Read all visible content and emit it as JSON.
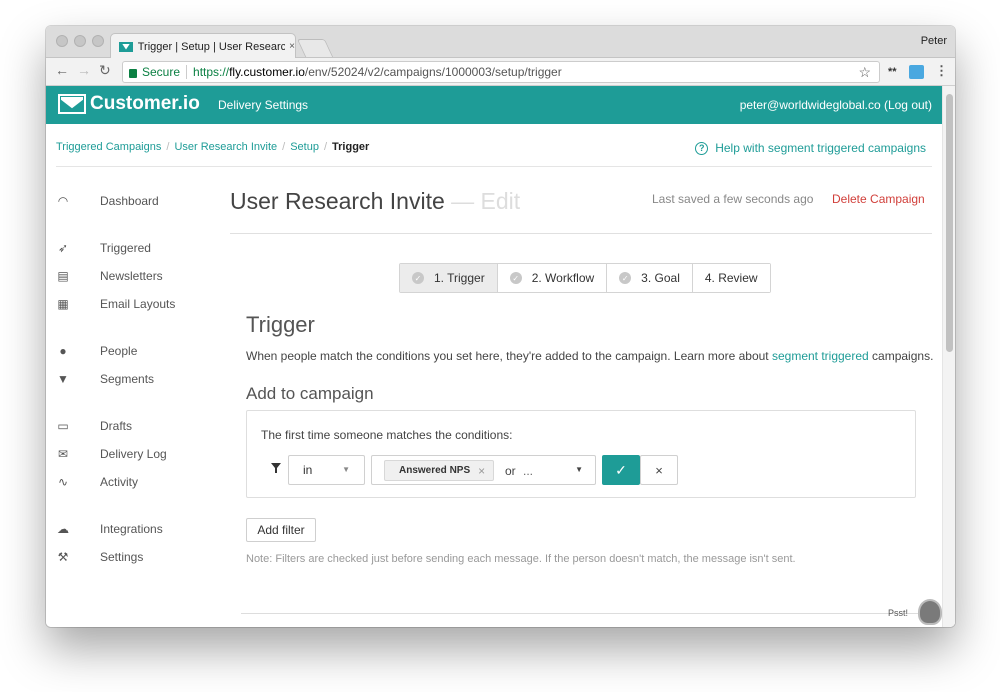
{
  "browser": {
    "tab_title": "Trigger | Setup | User Researc",
    "tab_close": "×",
    "profile_name": "Peter",
    "secure_label": "Secure",
    "url_scheme": "https://",
    "url_host": "fly.customer.io",
    "url_path": "/env/52024/v2/campaigns/1000003/setup/trigger",
    "ext_label": "**"
  },
  "header": {
    "logo_text": "Customer.io",
    "delivery_settings": "Delivery Settings",
    "user_email": "peter@worldwideglobal.co (Log out)"
  },
  "breadcrumb": {
    "items": [
      "Triggered Campaigns",
      "User Research Invite",
      "Setup"
    ],
    "current": "Trigger",
    "divider": "/"
  },
  "help_link": "Help with segment triggered campaigns",
  "sidebar": {
    "items": [
      {
        "label": "Dashboard",
        "icon": "gauge-icon"
      },
      {
        "label": "Triggered",
        "icon": "paper-plane-icon"
      },
      {
        "label": "Newsletters",
        "icon": "newspaper-icon"
      },
      {
        "label": "Email Layouts",
        "icon": "layout-icon"
      },
      {
        "label": "People",
        "icon": "person-icon"
      },
      {
        "label": "Segments",
        "icon": "funnel-icon"
      },
      {
        "label": "Drafts",
        "icon": "draft-icon"
      },
      {
        "label": "Delivery Log",
        "icon": "envelope-icon"
      },
      {
        "label": "Activity",
        "icon": "activity-icon"
      },
      {
        "label": "Integrations",
        "icon": "cloud-icon"
      },
      {
        "label": "Settings",
        "icon": "wrench-icon"
      }
    ]
  },
  "main": {
    "title": "User Research Invite",
    "title_edit": "— Edit",
    "last_saved": "Last saved a few seconds ago",
    "delete_label": "Delete Campaign",
    "steps": [
      {
        "label": "1. Trigger",
        "done": true
      },
      {
        "label": "2. Workflow",
        "done": true
      },
      {
        "label": "3. Goal",
        "done": true
      },
      {
        "label": "4. Review",
        "done": false
      }
    ],
    "trigger_heading": "Trigger",
    "trigger_desc_pre": "When people match the conditions you set here, they're added to the campaign. Learn more about ",
    "trigger_desc_link": "segment triggered",
    "trigger_desc_post": " campaigns.",
    "add_heading": "Add to campaign",
    "panel_text": "The first time someone matches the conditions:",
    "filter_operator": "in",
    "segment_chip": "Answered NPS",
    "chip_remove": "×",
    "or_label": "or",
    "or_placeholder": "...",
    "confirm_symbol": "✓",
    "cancel_symbol": "×",
    "add_filter_label": "Add filter",
    "note": "Note: Filters are checked just before sending each message. If the person doesn't match, the message isn't sent.",
    "psst_label": "Psst!"
  },
  "colors": {
    "brand": "#1e9c97",
    "danger": "#d13f3a"
  }
}
